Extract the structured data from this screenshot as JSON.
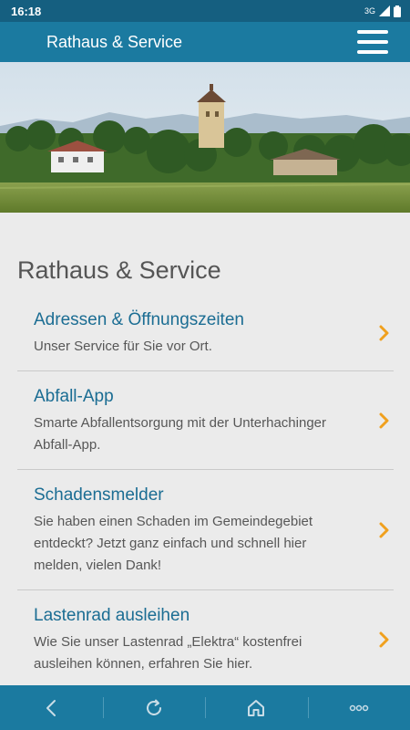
{
  "status_bar": {
    "time": "16:18",
    "network": "3G"
  },
  "app_bar": {
    "title": "Rathaus & Service",
    "menu_icon": "hamburger-menu-icon"
  },
  "hero": {
    "description": "Ortsansicht mit Wasserturm und Bergpanorama"
  },
  "page": {
    "title": "Rathaus & Service",
    "items": [
      {
        "title": "Adressen & Öffnungszeiten",
        "desc": "Unser Service für Sie vor Ort."
      },
      {
        "title": "Abfall-App",
        "desc": "Smarte Abfallentsorgung mit der Unterhachinger Abfall-App."
      },
      {
        "title": "Schadensmelder",
        "desc": "Sie haben einen Schaden im Gemeindegebiet entdeckt? Jetzt ganz einfach und schnell hier melden, vielen Dank!"
      },
      {
        "title": "Lastenrad ausleihen",
        "desc": "Wie Sie unser Lastenrad „Elektra“ kostenfrei ausleihen können, erfahren Sie hier."
      }
    ]
  },
  "colors": {
    "header": "#1b7aa0",
    "status": "#155f80",
    "link": "#1b6d93",
    "chevron": "#f0a01e"
  },
  "nav": {
    "icons": [
      "back-icon",
      "reload-icon",
      "home-icon",
      "more-icon"
    ]
  }
}
